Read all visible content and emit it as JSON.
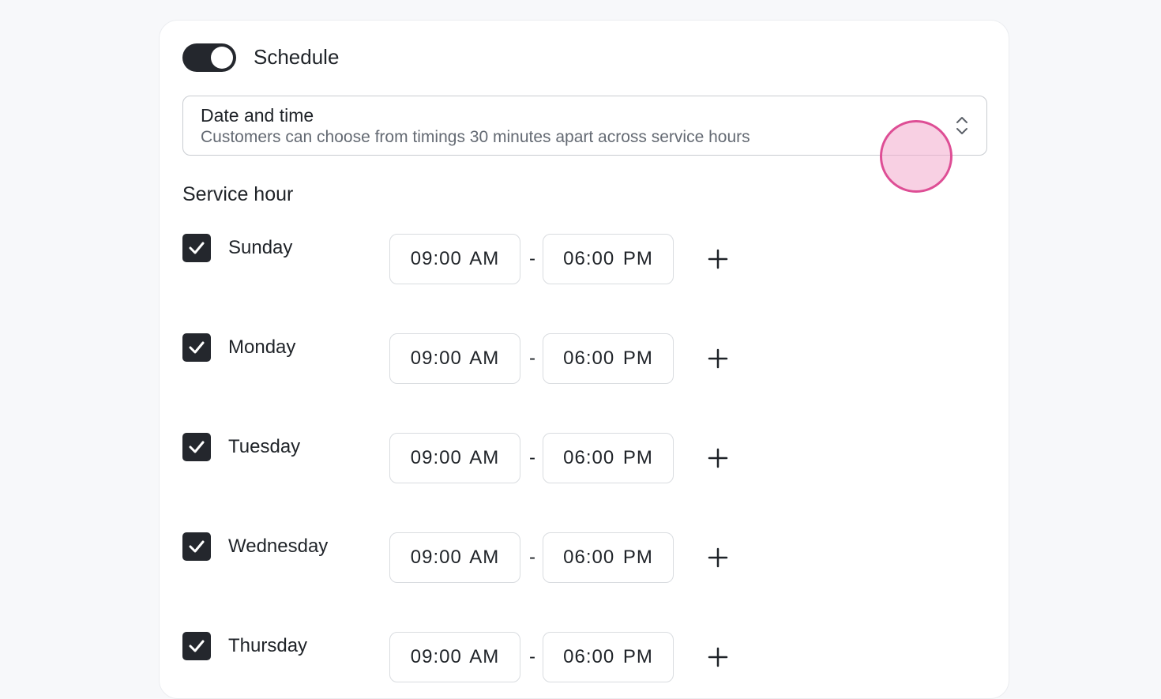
{
  "header": {
    "title": "Schedule",
    "toggle_on": true
  },
  "booking_type": {
    "title": "Date and time",
    "description": "Customers can choose from timings 30 minutes apart across service hours"
  },
  "service_hours": {
    "title": "Service hour",
    "separator": "-",
    "days": [
      {
        "label": "Sunday",
        "checked": true,
        "start": "09:00 AM",
        "end": "06:00 PM"
      },
      {
        "label": "Monday",
        "checked": true,
        "start": "09:00 AM",
        "end": "06:00 PM"
      },
      {
        "label": "Tuesday",
        "checked": true,
        "start": "09:00 AM",
        "end": "06:00 PM"
      },
      {
        "label": "Wednesday",
        "checked": true,
        "start": "09:00 AM",
        "end": "06:00 PM"
      },
      {
        "label": "Thursday",
        "checked": true,
        "start": "09:00 AM",
        "end": "06:00 PM"
      }
    ]
  },
  "colors": {
    "accent_dark": "#24272d",
    "cursor_fill": "#f2aacc",
    "cursor_stroke": "#de4e95"
  },
  "icons": {
    "toggle": "toggle-switch",
    "select": "chevron-up-down-icon",
    "check": "check-icon",
    "add": "plus-icon"
  }
}
